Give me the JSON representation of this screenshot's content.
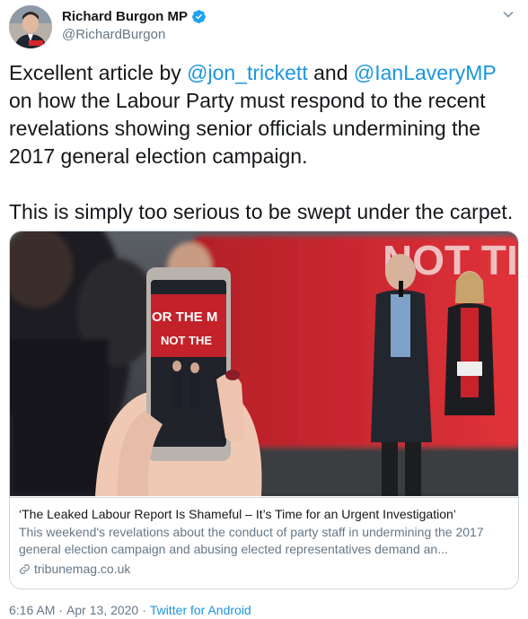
{
  "author": {
    "display_name": "Richard Burgon MP",
    "handle": "@RichardBurgon"
  },
  "tweet": {
    "para1_prefix": "Excellent article by ",
    "mention1": "@jon_trickett",
    "para1_and": " and ",
    "mention2": "@IanLaveryMP",
    "para1_suffix": " on how the Labour Party must respond to the recent revelations showing senior officials undermining the 2017 general election campaign.",
    "para2": "This is simply too serious to be swept under the carpet."
  },
  "card": {
    "image_text_bus": "NOT TI",
    "image_text_phone_1": "OR THE M",
    "image_text_phone_2": "NOT THE",
    "title": "‘The Leaked Labour Report Is Shameful – It’s Time for an Urgent Investigation’",
    "description": "This weekend's revelations about the conduct of party staff in undermining the 2017 general election campaign and abusing elected representatives demand an...",
    "domain": "tribunemag.co.uk"
  },
  "meta": {
    "time": "6:16 AM",
    "separator1": "·",
    "date": "Apr 13, 2020",
    "separator2": "·",
    "source": "Twitter for Android"
  },
  "colors": {
    "link": "#1b95e0",
    "secondary": "#657786",
    "verified": "#1da1f2",
    "bus_red": "#d7262e"
  },
  "icons": [
    "verified-badge-icon",
    "chevron-down-icon",
    "link-icon"
  ]
}
